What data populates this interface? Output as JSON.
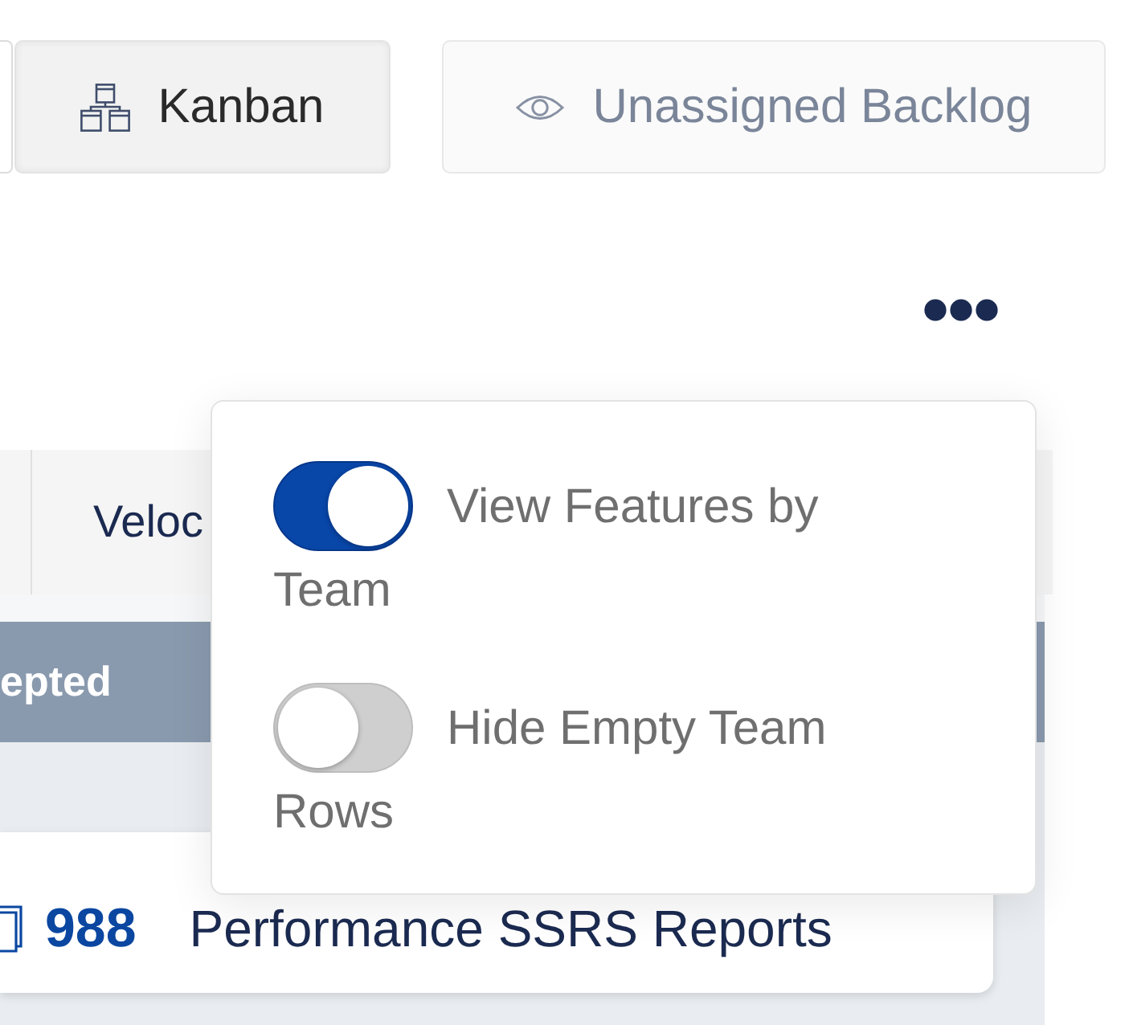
{
  "view_buttons": [
    {
      "selected": false
    },
    {
      "label": "Kanban",
      "selected": true
    }
  ],
  "backlog_button": {
    "label": "Unassigned Backlog",
    "active": false
  },
  "tab_bar": {
    "tabs": [
      {
        "label": "Veloc"
      }
    ]
  },
  "column": {
    "title": "epted"
  },
  "card": {
    "id": "988",
    "title": "Performance SSRS Reports"
  },
  "settings_menu": {
    "items": [
      {
        "label": "View Features by Team",
        "on": true
      },
      {
        "label": "Hide Empty Team Rows",
        "on": false
      }
    ]
  }
}
